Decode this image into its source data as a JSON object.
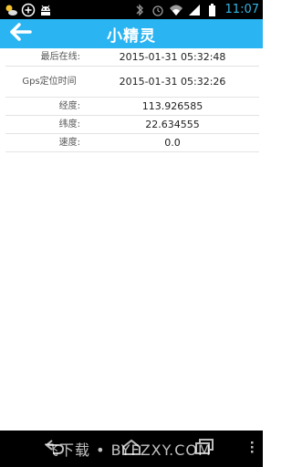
{
  "statusbar": {
    "time": "11:07",
    "left_icons": [
      "weather-icon",
      "add-circle-icon",
      "android-icon"
    ],
    "right_icons": [
      "bluetooth-icon",
      "alarm-icon",
      "wifi-icon",
      "signal-icon",
      "battery-icon"
    ]
  },
  "header": {
    "title": "小精灵",
    "back_icon": "back-arrow-icon",
    "background": "#2bb4f2"
  },
  "info": {
    "rows": [
      {
        "label": "最后在线:",
        "value": "2015-01-31 05:32:48"
      },
      {
        "label": "Gps定位时间",
        "value": "2015-01-31 05:32:26"
      },
      {
        "label": "经度:",
        "value": "113.926585"
      },
      {
        "label": "纬度:",
        "value": "22.634555"
      },
      {
        "label": "速度:",
        "value": "0.0"
      }
    ]
  },
  "navbar": {
    "watermark": "飞下载 • BYFZXY.COM",
    "buttons": [
      "back-icon",
      "home-icon",
      "recent-apps-icon",
      "menu-icon"
    ]
  },
  "colors": {
    "accent": "#2bb4f2",
    "clock": "#33b5e5"
  }
}
